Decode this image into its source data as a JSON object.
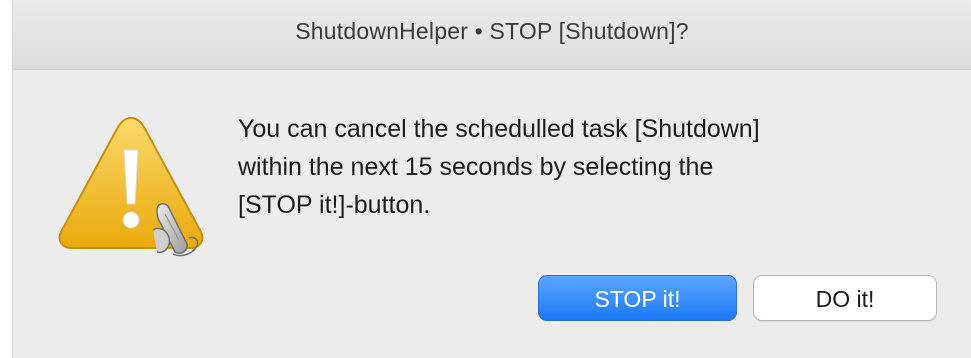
{
  "window": {
    "title": "ShutdownHelper • STOP [Shutdown]?"
  },
  "alert": {
    "icon": "warning-triangle-icon",
    "message_lines": [
      "You can cancel the schedulled task [Shutdown]",
      "within the next 15 seconds by selecting the",
      "[STOP it!]-button."
    ]
  },
  "buttons": {
    "stop_label": "STOP it!",
    "do_label": "DO it!"
  },
  "colors": {
    "accent": "#1e78f5",
    "warning": "#f2b410"
  }
}
